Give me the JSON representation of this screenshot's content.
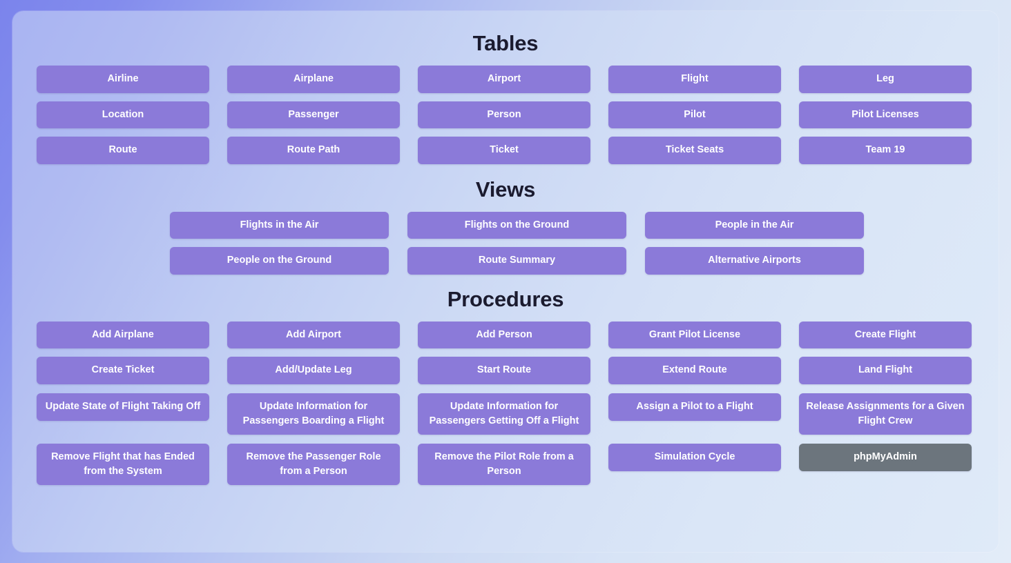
{
  "theme": {
    "button_color": "#8b7ad9",
    "secondary_button_color": "#6c757d",
    "heading_color": "#1b1b2f",
    "background_from": "#7b84ec",
    "background_to": "#e3ecf8"
  },
  "sections": {
    "tables": {
      "title": "Tables",
      "rows": [
        [
          "Airline",
          "Airplane",
          "Airport",
          "Flight",
          "Leg"
        ],
        [
          "Location",
          "Passenger",
          "Person",
          "Pilot",
          "Pilot Licenses"
        ],
        [
          "Route",
          "Route Path",
          "Ticket",
          "Ticket Seats",
          "Team 19"
        ]
      ]
    },
    "views": {
      "title": "Views",
      "rows": [
        [
          "Flights in the Air",
          "Flights on the Ground",
          "People in the Air"
        ],
        [
          "People on the Ground",
          "Route Summary",
          "Alternative Airports"
        ]
      ]
    },
    "procedures": {
      "title": "Procedures",
      "rows": [
        [
          "Add Airplane",
          "Add Airport",
          "Add Person",
          "Grant Pilot License",
          "Create Flight"
        ],
        [
          "Create Ticket",
          "Add/Update Leg",
          "Start Route",
          "Extend Route",
          "Land Flight"
        ],
        [
          "Update State of Flight Taking Off",
          "Update Information for Passengers Boarding a Flight",
          "Update Information for Passengers Getting Off a Flight",
          "Assign a Pilot to a Flight",
          "Release Assignments for a Given Flight Crew"
        ],
        [
          "Remove Flight that has Ended from the System",
          "Remove the Passenger Role from a Person",
          "Remove the Pilot Role from a Person",
          "Simulation Cycle",
          "phpMyAdmin"
        ]
      ]
    }
  }
}
